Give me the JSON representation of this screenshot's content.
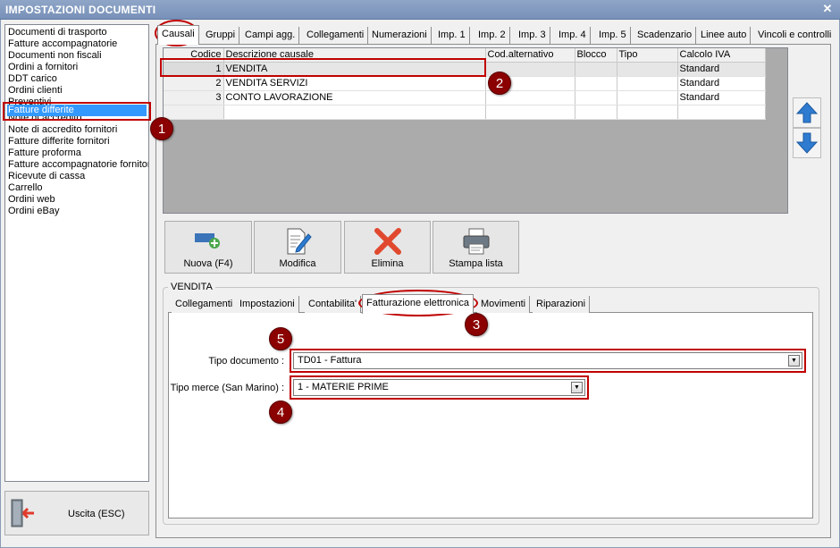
{
  "window": {
    "title": "IMPOSTAZIONI DOCUMENTI",
    "close_glyph": "✕"
  },
  "sidebar": {
    "items": [
      "Documenti di trasporto",
      "Fatture accompagnatorie",
      "Documenti non fiscali",
      "Ordini a fornitori",
      "DDT carico",
      "Ordini clienti",
      "Preventivi",
      "Fatture differite",
      "Note di accredito",
      "Note di accredito fornitori",
      "Fatture differite fornitori",
      "Fatture proforma",
      "Fatture accompagnatorie fornitori",
      "Ricevute di cassa",
      "Carrello",
      "Ordini web",
      "Ordini eBay"
    ],
    "selected": "Fatture differite",
    "exit_label": "Uscita (ESC)"
  },
  "top_tabs": [
    "Causali",
    "Gruppi",
    "Campi agg.",
    "Collegamenti",
    "Numerazioni",
    "Imp. 1",
    "Imp. 2",
    "Imp. 3",
    "Imp. 4",
    "Imp. 5",
    "Scadenzario",
    "Linee auto",
    "Vincoli e controlli"
  ],
  "grid": {
    "columns": [
      "Codice",
      "Descrizione causale",
      "Cod.alternativo",
      "Blocco",
      "Tipo",
      "Calcolo IVA"
    ],
    "rows": [
      [
        "1",
        "VENDITA",
        "",
        "",
        "",
        "Standard"
      ],
      [
        "2",
        "VENDITA SERVIZI",
        "",
        "",
        "",
        "Standard"
      ],
      [
        "3",
        "CONTO LAVORAZIONE",
        "",
        "",
        "",
        "Standard"
      ]
    ]
  },
  "actions": {
    "new": "Nuova (F4)",
    "edit": "Modifica",
    "delete": "Elimina",
    "print": "Stampa lista"
  },
  "detail": {
    "group_label": "VENDITA",
    "tabs": [
      "Collegamenti",
      "Impostazioni",
      "Contabilita'",
      "Fatturazione elettronica",
      "Movimenti",
      "Riparazioni"
    ],
    "tipo_documento_label": "Tipo documento :",
    "tipo_documento_value": "TD01 - Fattura",
    "tipo_merce_label": "Tipo merce (San Marino) :",
    "tipo_merce_value": "1 - MATERIE PRIME"
  },
  "annotations": [
    "1",
    "2",
    "3",
    "4",
    "5"
  ],
  "colors": {
    "selection": "#3399ff",
    "annotation": "#c00000",
    "badge": "#8b0000"
  }
}
